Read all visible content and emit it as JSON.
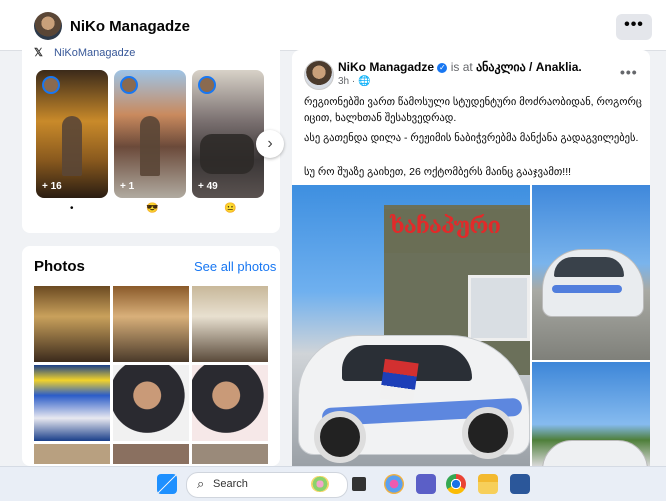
{
  "header": {
    "page_name": "NiKo Managadze",
    "more_label": "•••"
  },
  "intro": {
    "x_handle": "NiKoManagadze",
    "x_glyph": "𝕏"
  },
  "stories": [
    {
      "count": "+ 16",
      "reaction": "•"
    },
    {
      "count": "+ 1",
      "reaction": "😎"
    },
    {
      "count": "+ 49",
      "reaction": "😐"
    }
  ],
  "stories_next": "›",
  "photos": {
    "title": "Photos",
    "see_all": "See all photos"
  },
  "post": {
    "author": "NiKo Managadze",
    "verified_glyph": "✓",
    "is_at": "is at",
    "place": "ანაკლია / Anaklia.",
    "time": "3h",
    "privacy_icon": "globe-icon",
    "privacy_glyph": "🌐",
    "more_label": "•••",
    "paragraphs": [
      "რეგიონებში ვართ წამოსული სტუდენტური მოძრაობიდან, როგორც იცით, ხალხთან შესახვედრად.",
      "ასე გათენდა დილა - რეჟიმის ნაბიჭვრებმა მანქანა გადაგვილებეს.",
      "სუ რო შუაზე გაიხეთ, 26 ოქტომბერს მაინც გააჯვამთ!!!"
    ],
    "sign_text": "ხაჩაპური"
  },
  "taskbar": {
    "search_label": "Search",
    "icons": [
      "windows-start-icon",
      "search-icon",
      "widgets-icon",
      "task-view-icon",
      "copilot-icon",
      "teams-icon",
      "chrome-icon",
      "file-explorer-icon",
      "word-icon"
    ]
  },
  "colors": {
    "link": "#1877f2",
    "bg": "#f0f2f5",
    "card": "#ffffff",
    "taskbar": "#e9eef6"
  }
}
